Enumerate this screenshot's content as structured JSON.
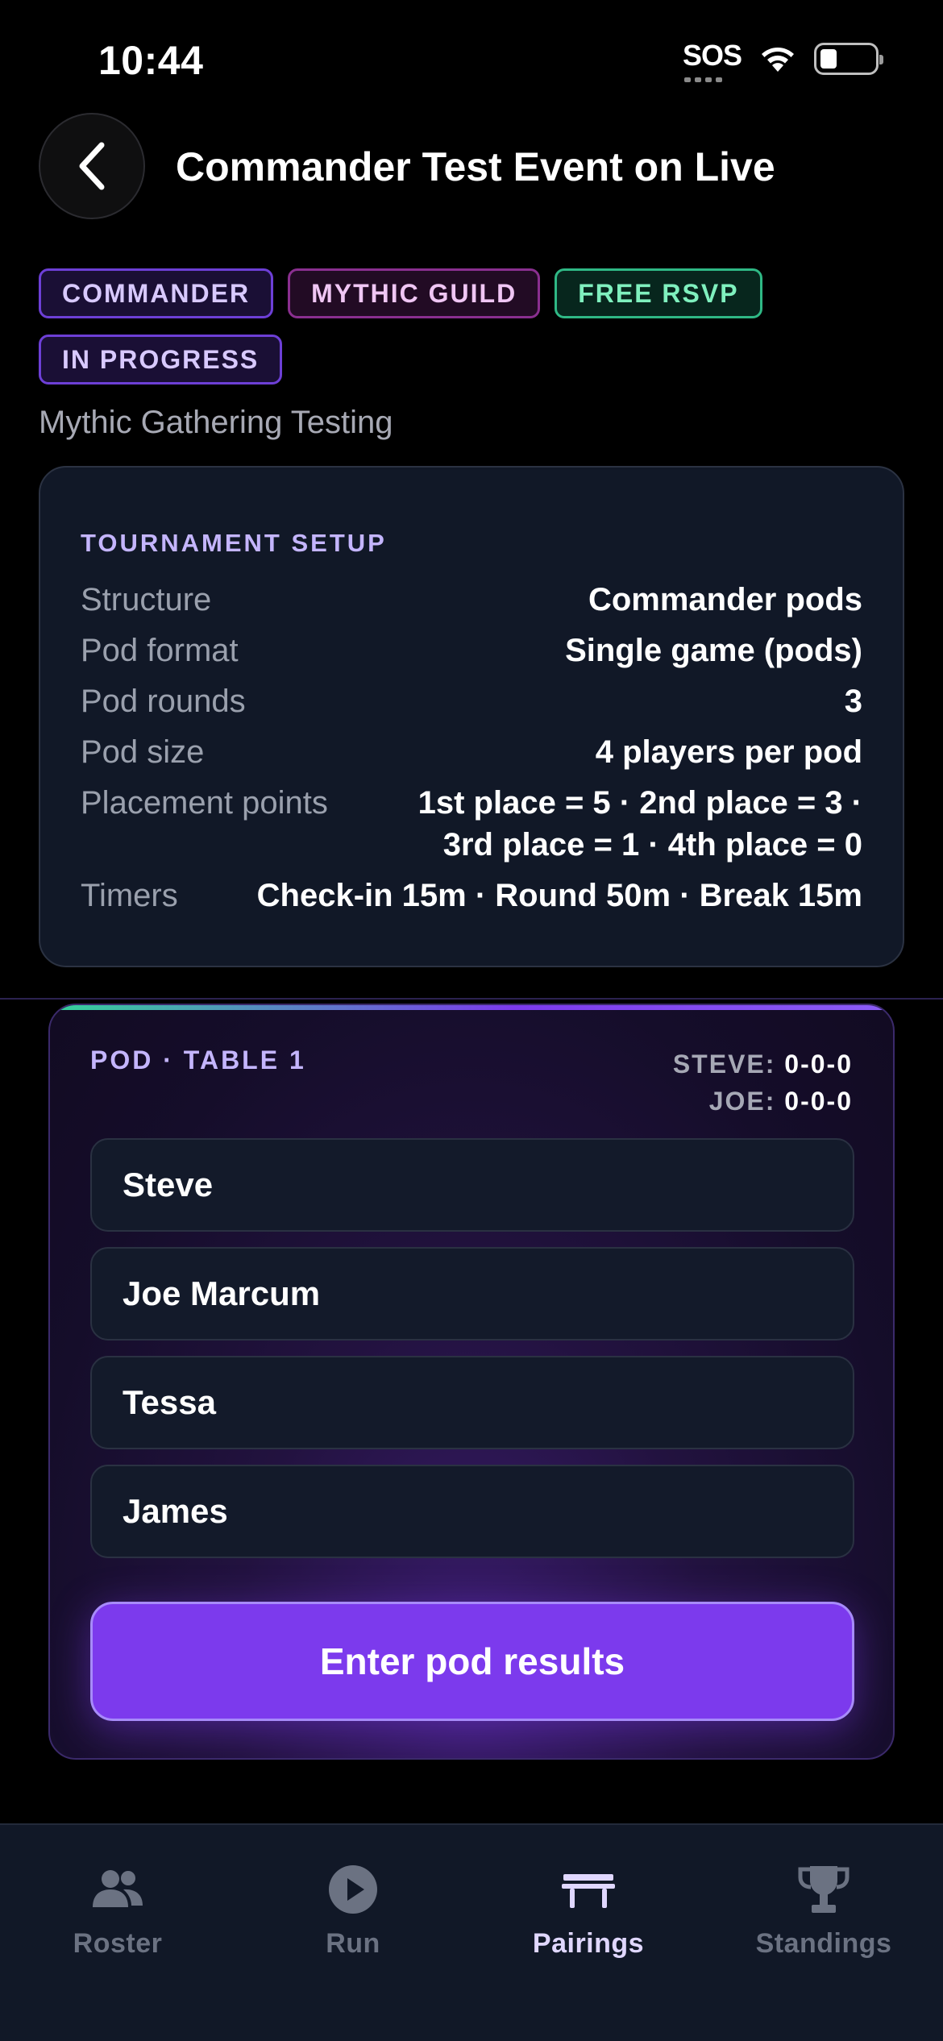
{
  "status_bar": {
    "time": "10:44",
    "sos": "SOS"
  },
  "header": {
    "title": "Commander Test Event on Live"
  },
  "badges": [
    {
      "label": "COMMANDER",
      "style": "purple"
    },
    {
      "label": "MYTHIC GUILD",
      "style": "magenta"
    },
    {
      "label": "FREE RSVP",
      "style": "green"
    },
    {
      "label": "IN PROGRESS",
      "style": "purple"
    }
  ],
  "subtitle": "Mythic Gathering Testing",
  "setup": {
    "heading": "TOURNAMENT SETUP",
    "rows": [
      {
        "key": "Structure",
        "value": "Commander pods"
      },
      {
        "key": "Pod format",
        "value": "Single game (pods)"
      },
      {
        "key": "Pod rounds",
        "value": "3"
      },
      {
        "key": "Pod size",
        "value": "4 players per pod"
      },
      {
        "key": "Placement points",
        "value": "1st place = 5 · 2nd place = 3 · 3rd place = 1 · 4th place = 0"
      },
      {
        "key": "Timers",
        "value": "Check-in 15m · Round 50m · Break 15m"
      }
    ]
  },
  "pod": {
    "label": "POD · TABLE 1",
    "records": [
      {
        "name": "STEVE:",
        "record": "0-0-0"
      },
      {
        "name": "JOE:",
        "record": "0-0-0"
      }
    ],
    "players": [
      "Steve",
      "Joe Marcum",
      "Tessa",
      "James"
    ],
    "cta": "Enter pod results"
  },
  "tabs": [
    {
      "label": "Roster",
      "icon": "people-icon",
      "active": false
    },
    {
      "label": "Run",
      "icon": "play-icon",
      "active": false
    },
    {
      "label": "Pairings",
      "icon": "table-icon",
      "active": true
    },
    {
      "label": "Standings",
      "icon": "trophy-icon",
      "active": false
    }
  ],
  "colors": {
    "accent": "#7c3aed",
    "accent_light": "#c4b5fd",
    "card_bg": "#111827",
    "success": "#34d399"
  }
}
